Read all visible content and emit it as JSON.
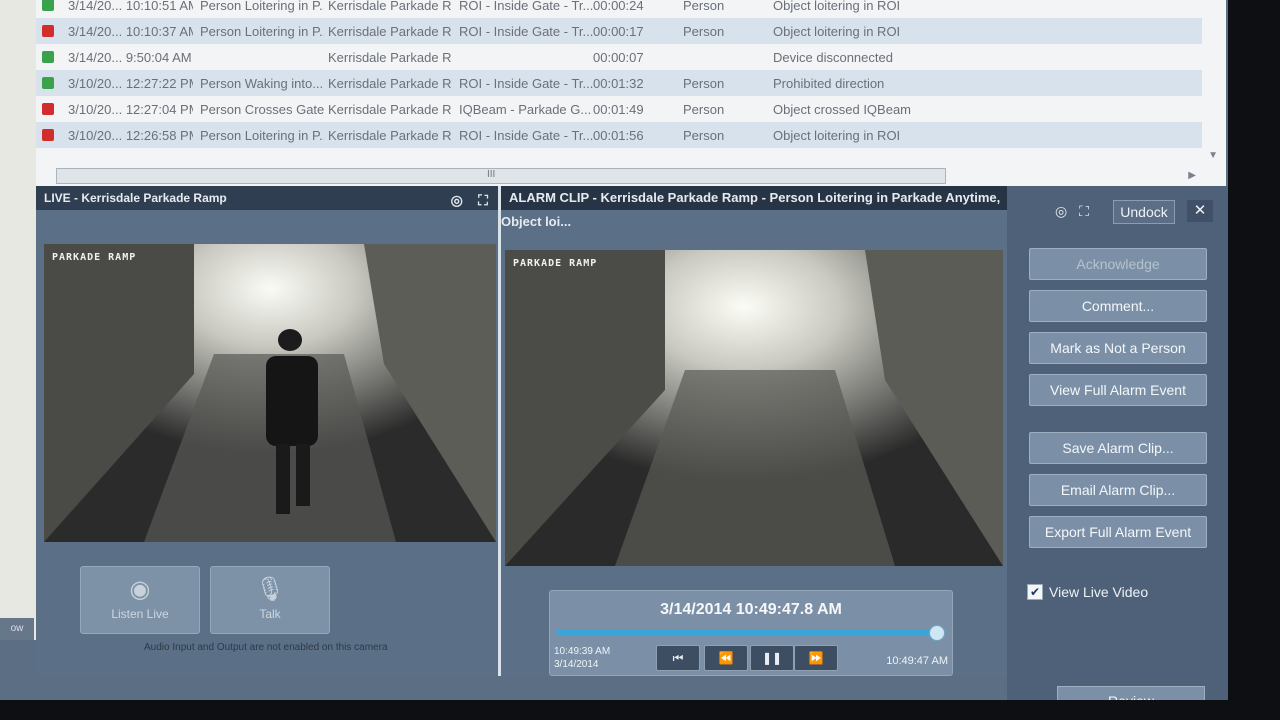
{
  "alarm_list": {
    "rows": [
      {
        "status": "green",
        "date": "3/14/20... 10:10:51 AM",
        "rule": "Person Loitering in P...",
        "site": "Kerrisdale Parkade R...",
        "roi": "ROI - Inside Gate - Tr...",
        "duration": "00:00:24",
        "object": "Person",
        "description": "Object loitering in ROI"
      },
      {
        "status": "red",
        "date": "3/14/20... 10:10:37 AM",
        "rule": "Person Loitering in P...",
        "site": "Kerrisdale Parkade R...",
        "roi": "ROI - Inside Gate - Tr...",
        "duration": "00:00:17",
        "object": "Person",
        "description": "Object loitering in ROI"
      },
      {
        "status": "green",
        "date": "3/14/20... 9:50:04 AM",
        "rule": "",
        "site": "Kerrisdale Parkade R...",
        "roi": "",
        "duration": "00:00:07",
        "object": "",
        "description": "Device disconnected"
      },
      {
        "status": "green",
        "date": "3/10/20... 12:27:22 PM",
        "rule": "Person Waking into...",
        "site": "Kerrisdale Parkade R...",
        "roi": "ROI - Inside Gate - Tr...",
        "duration": "00:01:32",
        "object": "Person",
        "description": "Prohibited direction"
      },
      {
        "status": "red",
        "date": "3/10/20... 12:27:04 PM",
        "rule": "Person Crosses Gate...",
        "site": "Kerrisdale Parkade R...",
        "roi": "IQBeam - Parkade G...",
        "duration": "00:01:49",
        "object": "Person",
        "description": "Object crossed IQBeam"
      },
      {
        "status": "red",
        "date": "3/10/20... 12:26:58 PM",
        "rule": "Person Loitering in P...",
        "site": "Kerrisdale Parkade R...",
        "roi": "ROI - Inside Gate - Tr...",
        "duration": "00:01:56",
        "object": "Person",
        "description": "Object loitering in ROI"
      }
    ],
    "scroll_grip": "III"
  },
  "live": {
    "title": "LIVE - Kerrisdale Parkade Ramp",
    "camera_label": "PARKADE RAMP",
    "listen_label": "Listen Live",
    "talk_label": "Talk",
    "audio_note": "Audio Input and Output are not enabled on this camera"
  },
  "clip": {
    "title": "ALARM CLIP - Kerrisdale Parkade Ramp - Person Loitering in Parkade Anytime, Object loi...",
    "camera_label": "PARKADE RAMP",
    "current_time": "3/14/2014 10:49:47.8 AM",
    "start_time": "10:49:39 AM",
    "start_date": "3/14/2014",
    "end_time": "10:49:47 AM",
    "progress": 0.98
  },
  "actions": {
    "undock": "Undock",
    "close": "✕",
    "acknowledge": "Acknowledge",
    "comment": "Comment...",
    "mark_not_person": "Mark as Not a Person",
    "view_full": "View Full Alarm Event",
    "save_clip": "Save Alarm Clip...",
    "email_clip": "Email Alarm Clip...",
    "export_full": "Export Full Alarm Event",
    "view_live_label": "View Live Video",
    "view_live_checked": true,
    "review": "Review"
  },
  "left_strip": {
    "mini_label": "ow"
  },
  "colors": {
    "status_green": "#3aa24a",
    "status_red": "#d22c2c",
    "accent_track": "#3aa6d8"
  }
}
